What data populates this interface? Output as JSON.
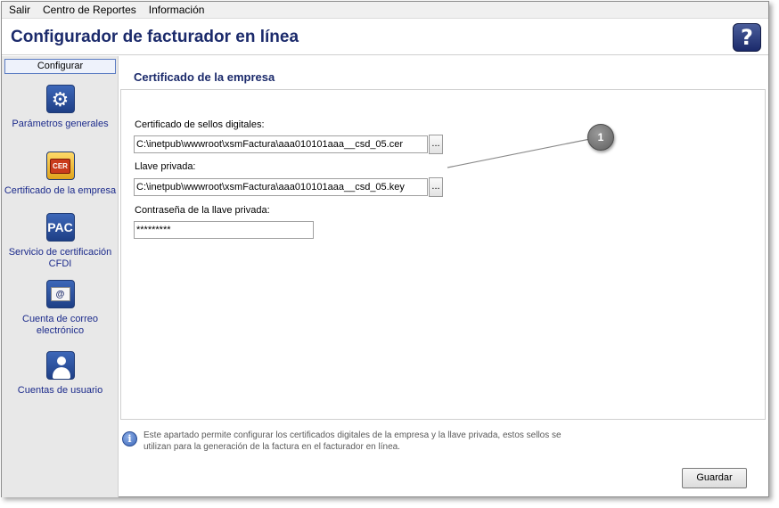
{
  "menu": {
    "items": [
      {
        "label": "Salir"
      },
      {
        "label": "Centro de Reportes"
      },
      {
        "label": "Información"
      }
    ]
  },
  "app": {
    "title": "Configurador de facturador en línea",
    "help_label": "?"
  },
  "sidebar": {
    "header": "Configurar",
    "items": [
      {
        "label": "Parámetros generales",
        "icon": "gear-icon"
      },
      {
        "label": "Certificado de la empresa",
        "icon": "certificate-icon",
        "icon_text": "CER"
      },
      {
        "label": "Servicio de certificación CFDI",
        "icon": "pac-icon",
        "icon_text": "PAC"
      },
      {
        "label": "Cuenta de correo electrónico",
        "icon": "mail-icon",
        "icon_text": "@"
      },
      {
        "label": "Cuentas de usuario",
        "icon": "user-icon"
      }
    ]
  },
  "section": {
    "title": "Certificado de la empresa"
  },
  "form": {
    "cert_label": "Certificado de sellos digitales:",
    "cert_value": "C:\\inetpub\\wwwroot\\xsmFactura\\aaa010101aaa__csd_05.cer",
    "key_label": "Llave privada:",
    "key_value": "C:\\inetpub\\wwwroot\\xsmFactura\\aaa010101aaa__csd_05.key",
    "password_label": "Contraseña de la llave privada:",
    "password_value": "*********",
    "browse_label": "..."
  },
  "callout": {
    "number": "1"
  },
  "info": {
    "text": "Este apartado permite configurar los certificados digitales de la empresa y la llave privada, estos sellos se utilizan para la generación de la factura en el facturador en línea."
  },
  "actions": {
    "save_label": "Guardar"
  }
}
